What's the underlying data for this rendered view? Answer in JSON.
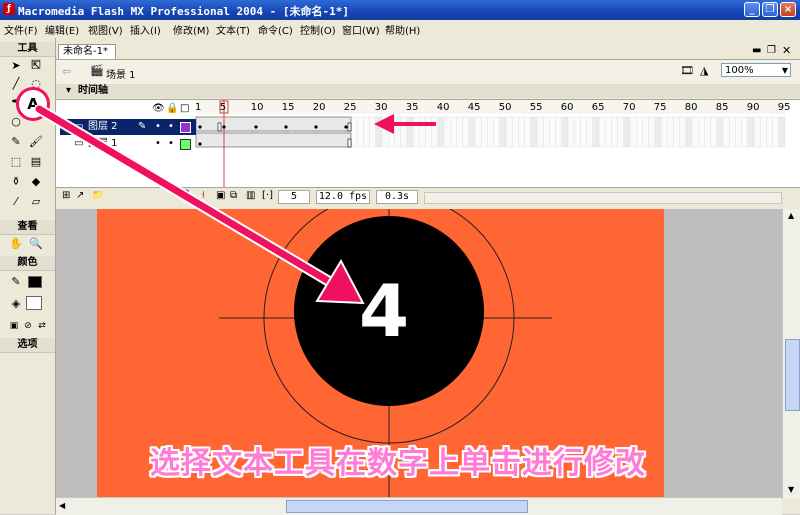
{
  "window": {
    "title": "Macromedia Flash MX Professional 2004 - [未命名-1*]",
    "buttons": {
      "minimize": "_",
      "restore": "❐",
      "close": "×"
    }
  },
  "menu": [
    "文件(F)",
    "编辑(E)",
    "视图(V)",
    "插入(I)",
    "修改(M)",
    "文本(T)",
    "命令(C)",
    "控制(O)",
    "窗口(W)",
    "帮助(H)"
  ],
  "toolbox": {
    "title": "工具",
    "view_label": "查看",
    "color_label": "颜色",
    "options_label": "选项",
    "text_tool_glyph": "A"
  },
  "document": {
    "tab": "未命名-1*",
    "scene": "场景 1",
    "zoom": "100%"
  },
  "timeline": {
    "header": "时间轴",
    "ruler_ticks": [
      "1",
      "5",
      "10",
      "15",
      "20",
      "25",
      "30",
      "35",
      "40",
      "45",
      "50",
      "55",
      "60",
      "65",
      "70",
      "75",
      "80",
      "85",
      "90",
      "95"
    ],
    "layers": [
      {
        "name": "图层 2",
        "selected": true,
        "color": "#9933cc"
      },
      {
        "name": "图层 1",
        "selected": false,
        "color": "#66ff66"
      }
    ],
    "current_frame": "5",
    "fps": "12.0 fps",
    "elapsed": "0.3s"
  },
  "stage": {
    "digit": "4",
    "background": "#ff6633"
  },
  "annotation": {
    "caption": "选择文本工具在数字上单击进行修改",
    "arrow_color": "#f01060"
  }
}
